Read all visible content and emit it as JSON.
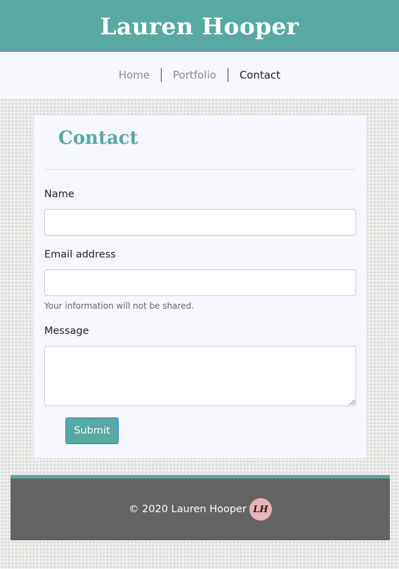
{
  "header": {
    "title": "Lauren Hooper"
  },
  "nav": {
    "items": [
      {
        "label": "Home"
      },
      {
        "label": "Portfolio"
      },
      {
        "label": "Contact"
      }
    ],
    "active": "Contact"
  },
  "contact_form": {
    "title": "Contact",
    "name_label": "Name",
    "name_value": "",
    "email_label": "Email address",
    "email_value": "",
    "email_help": "Your information will not be shared.",
    "message_label": "Message",
    "message_value": "",
    "submit_label": "Submit"
  },
  "footer": {
    "text": "© 2020 Lauren Hooper",
    "logo_text": "LH"
  },
  "colors": {
    "accent": "#57a9a1",
    "footer_bg": "#636363",
    "logo_bg": "#e8b4b8"
  }
}
